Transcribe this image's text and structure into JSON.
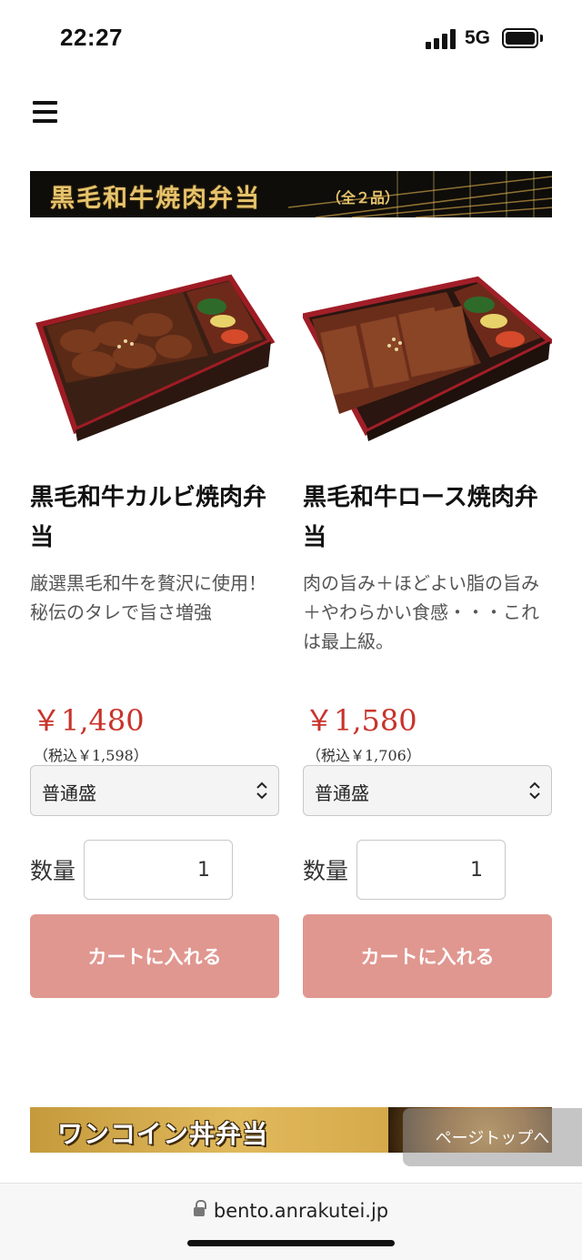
{
  "status_bar": {
    "time": "22:27",
    "network": "5G"
  },
  "banners": {
    "wagyu": {
      "title": "黒毛和牛焼肉弁当",
      "subtitle": "（全２品）"
    },
    "onecoin": {
      "title": "ワンコイン丼弁当"
    }
  },
  "products": [
    {
      "name": "黒毛和牛カルビ焼肉弁当",
      "description": "厳選黒毛和牛を贅沢に使用！秘伝のタレで旨さ増強",
      "price": "￥1,480",
      "tax_included": "（税込￥1,598）",
      "size_selected": "普通盛",
      "quantity_label": "数量",
      "quantity": "1",
      "cart_label": "カートに入れる"
    },
    {
      "name": "黒毛和牛ロース焼肉弁当",
      "description": "肉の旨み＋ほどよい脂の旨み＋やわらかい食感・・・これは最上級。",
      "price": "￥1,580",
      "tax_included": "（税込￥1,706）",
      "size_selected": "普通盛",
      "quantity_label": "数量",
      "quantity": "1",
      "cart_label": "カートに入れる"
    }
  ],
  "page_top_label": "ページトップへ",
  "browser": {
    "url": "bento.anrakutei.jp"
  },
  "colors": {
    "price_red": "#c8332b",
    "cart_button": "#e09790",
    "banner_gold": "#e6c36c"
  }
}
